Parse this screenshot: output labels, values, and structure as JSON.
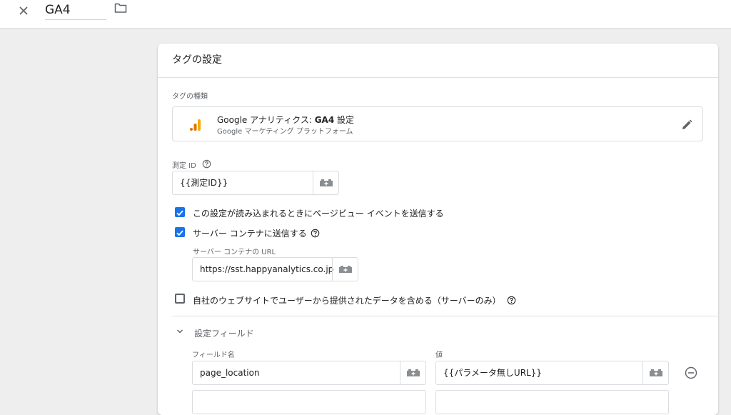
{
  "topbar": {
    "tag_name": "GA4"
  },
  "card": {
    "header": "タグの設定",
    "tag_type_label": "タグの種類",
    "tag_type": {
      "brand": "Google",
      "title_rest": " アナリティクス: ",
      "title_bold": "GA4",
      "title_suffix": " 設定",
      "subtitle": "Google マーケティング プラットフォーム"
    },
    "measurement_id": {
      "label": "測定 ID",
      "value": "{{測定ID}}"
    },
    "checkbox_pageview": {
      "label": "この設定が読み込まれるときにページビュー イベントを送信する",
      "checked": true
    },
    "checkbox_server": {
      "label": "サーバー コンテナに送信する",
      "checked": true
    },
    "server_url": {
      "label": "サーバー コンテナの URL",
      "value": "https://sst.happyanalytics.co.jp"
    },
    "checkbox_user_data": {
      "label": "自社のウェブサイトでユーザーから提供されたデータを含める（サーバーのみ）",
      "checked": false
    },
    "fields_section": {
      "title": "設定フィールド",
      "col_name": "フィールド名",
      "col_value": "値",
      "rows": [
        {
          "name": "page_location",
          "value": "{{パラメータ無しURL}}"
        }
      ]
    }
  },
  "colors": {
    "accent": "#1a73e8",
    "ga_orange": "#f9ab00",
    "ga_dark_orange": "#e37400"
  }
}
